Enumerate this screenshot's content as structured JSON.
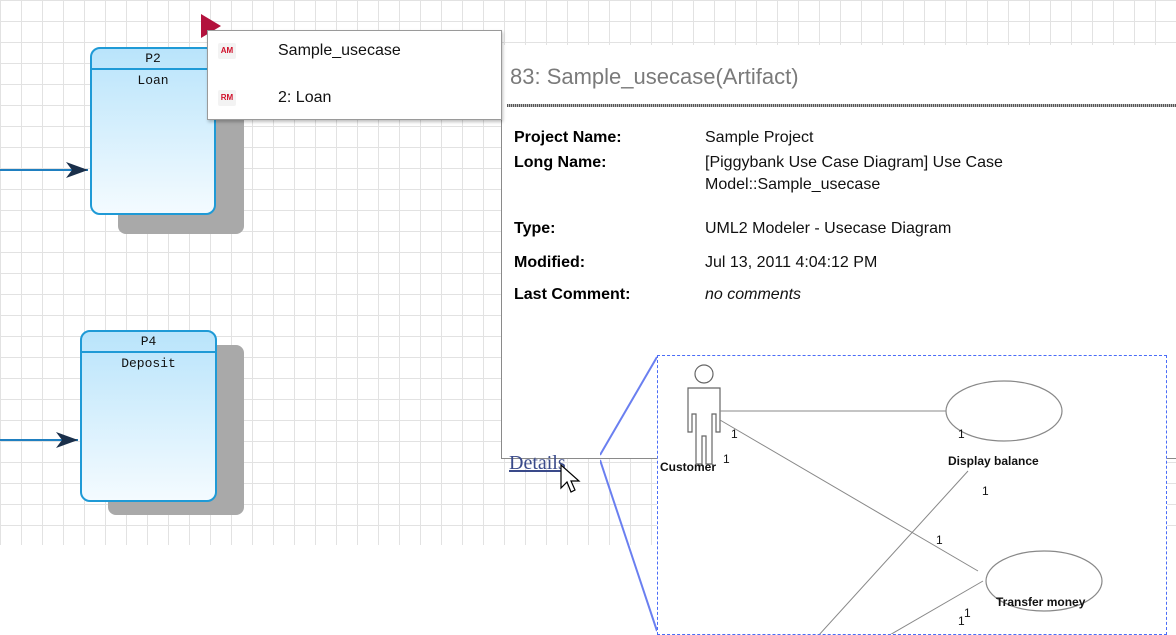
{
  "canvas": {
    "processes": [
      {
        "id": "P2",
        "label": "Loan"
      },
      {
        "id": "P4",
        "label": "Deposit"
      }
    ]
  },
  "menu": {
    "items": [
      {
        "badge": "AM",
        "label": "Sample_usecase"
      },
      {
        "badge": "RM",
        "label": "2: Loan"
      }
    ]
  },
  "popup": {
    "title": "83:  Sample_usecase(Artifact)",
    "properties": [
      {
        "label": "Project Name:",
        "value": "Sample Project"
      },
      {
        "label": "Long Name:",
        "value": "[Piggybank Use Case Diagram] Use Case",
        "value2": "Model::Sample_usecase"
      },
      {
        "label": "Type:",
        "value": "UML2 Modeler - Usecase Diagram"
      },
      {
        "label": "Modified:",
        "value": "Jul 13, 2011 4:04:12 PM"
      },
      {
        "label": "Last Comment:",
        "value": "no comments"
      }
    ],
    "details_link": "Details"
  },
  "thumbnail": {
    "actor": "Customer",
    "usecases": [
      "Display balance",
      "Transfer money"
    ],
    "multiplicities": [
      "1",
      "1",
      "1",
      "1",
      "1",
      "1",
      "1"
    ]
  }
}
